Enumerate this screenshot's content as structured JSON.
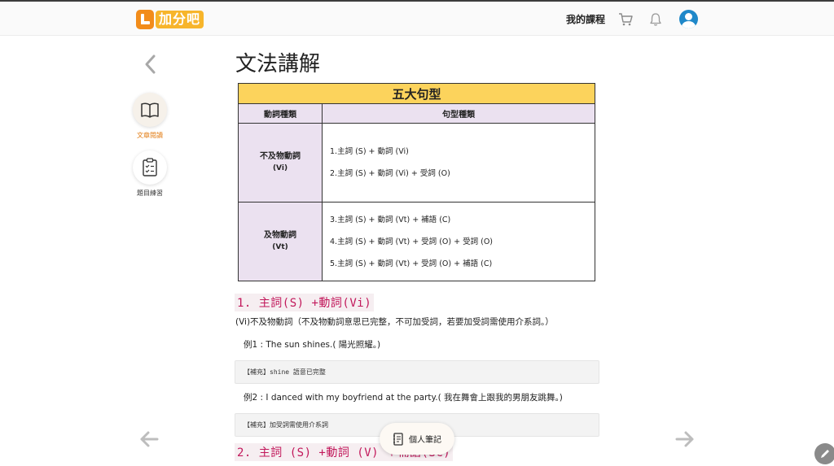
{
  "header": {
    "logo_text": "加分吧",
    "my_courses": "我的課程",
    "icons": [
      "cart-icon",
      "bell-icon",
      "user-avatar-icon"
    ]
  },
  "sidebar": {
    "items": [
      {
        "label": "文章閱讀",
        "icon": "book-icon",
        "active": true
      },
      {
        "label": "題目練習",
        "icon": "clipboard-checklist-icon",
        "active": false
      }
    ]
  },
  "main": {
    "title": "文法講解",
    "table": {
      "title": "五大句型",
      "col_headers": [
        "動詞種類",
        "句型種類"
      ],
      "rows": [
        {
          "category": "不及物動詞",
          "sub": "(Vi)",
          "patterns": [
            "1.主詞 (S) + 動詞 (Vi)",
            "2.主詞 (S) + 動詞 (Vi) + 受詞 (O)"
          ]
        },
        {
          "category": "及物動詞",
          "sub": "(Vt)",
          "patterns": [
            "3.主詞 (S) + 動詞 (Vt) + 補語 (C)",
            "4.主詞 (S) + 動詞 (Vt) + 受詞 (O) + 受詞 (O)",
            "5.主詞 (S) + 動詞 (Vt) + 受詞 (O) + 補語 (C)"
          ]
        }
      ]
    },
    "section1": {
      "heading": "1. 主詞(S) +動詞(Vi)",
      "desc": "(Vi)不及物動詞（不及物動詞意思已完整，不可加受詞，若要加受詞需使用介系詞。）",
      "example1": "例1 : The sun shines.( 陽光照耀。)",
      "note1": "【補充】shine 語意已完整",
      "example2": "例2 : I danced with my boyfriend at the party.( 我在舞會上跟我的男朋友跳舞。)",
      "note2": "【補充】加受詞需使用介系詞"
    },
    "section2": {
      "heading": "2. 主詞 (S)  +動詞 (V) ＋補語(SC)"
    }
  },
  "notes_button": {
    "label": "個人筆記",
    "icon": "notebook-icon"
  },
  "colors": {
    "table_title_bg": "#fcd35c",
    "table_header_bg": "#ebe1f0",
    "heading_color": "#c2185b",
    "accent_orange": "#e27b12"
  }
}
